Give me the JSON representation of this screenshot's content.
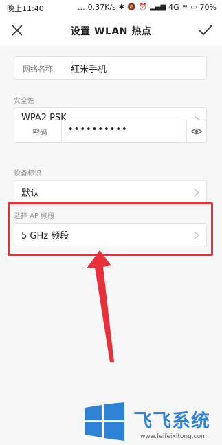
{
  "status": {
    "time": "晚上11:40",
    "dots": "...",
    "net_speed": "0.37K/s",
    "signal": "4G",
    "battery": "70%"
  },
  "nav": {
    "title": "设置 WLAN 热点"
  },
  "form": {
    "name_label": "网络名称",
    "name_value": "红米手机",
    "security_section": "安全性",
    "security_value": "WPA2 PSK",
    "password_label": "密码",
    "password_value": "••••••••••",
    "device_section": "设备标识",
    "device_value": "默认",
    "band_section": "选择 AP 频段",
    "band_value": "5 GHz 频段"
  },
  "watermark": {
    "brand": "飞飞系统",
    "url": "www.feifeixitong.com"
  },
  "colors": {
    "highlight": "#e8303a",
    "brand_blue": "#2d82d6"
  }
}
